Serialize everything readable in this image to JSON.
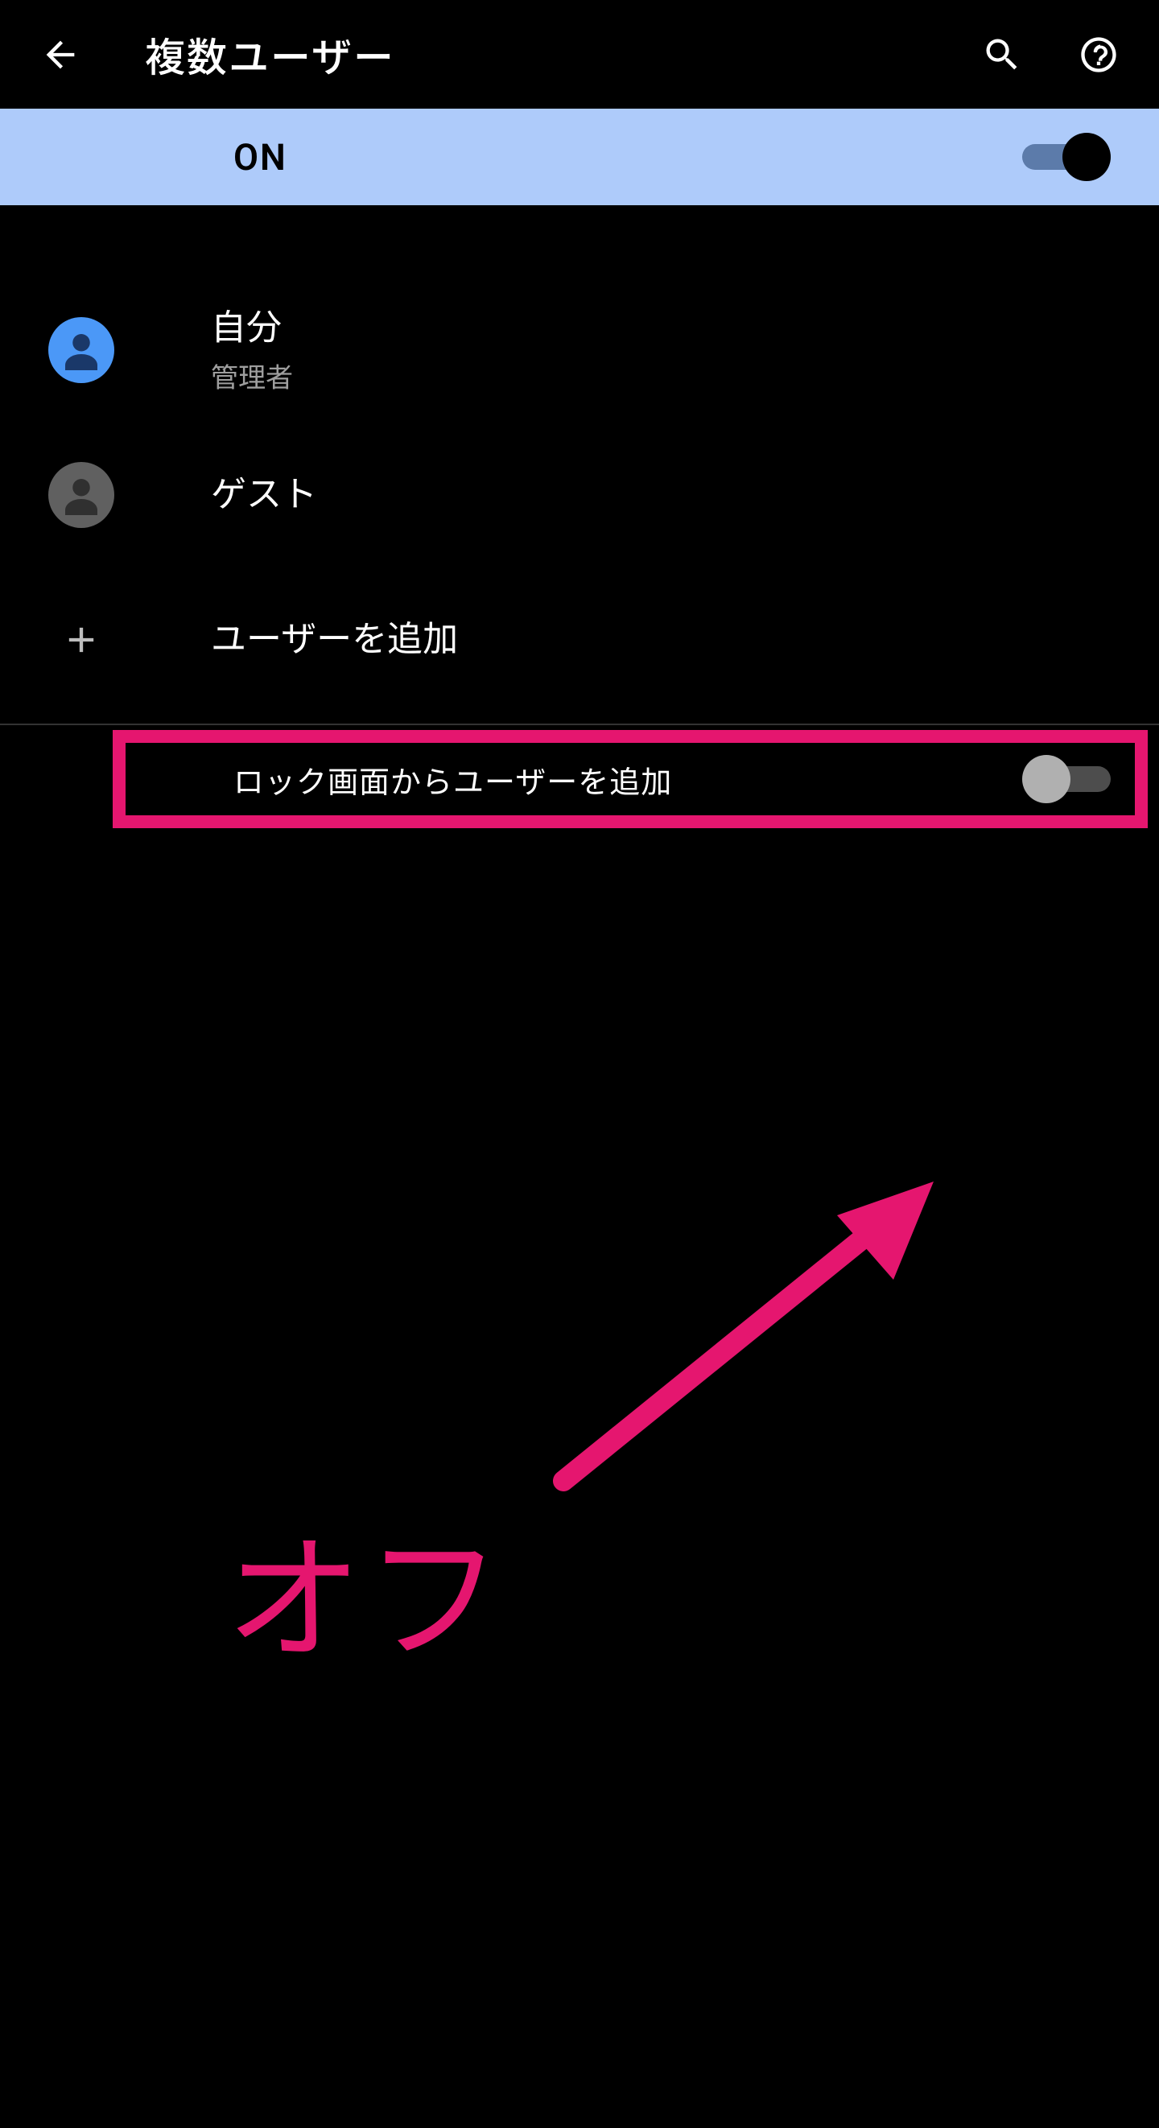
{
  "header": {
    "title": "複数ユーザー"
  },
  "master_toggle": {
    "label": "ON",
    "state": "on"
  },
  "users": {
    "self": {
      "name": "自分",
      "role": "管理者"
    },
    "guest": {
      "name": "ゲスト"
    },
    "add_label": "ユーザーを追加"
  },
  "lock_screen": {
    "label": "ロック画面からユーザーを追加",
    "state": "off"
  },
  "annotation": {
    "off_label": "オフ"
  }
}
